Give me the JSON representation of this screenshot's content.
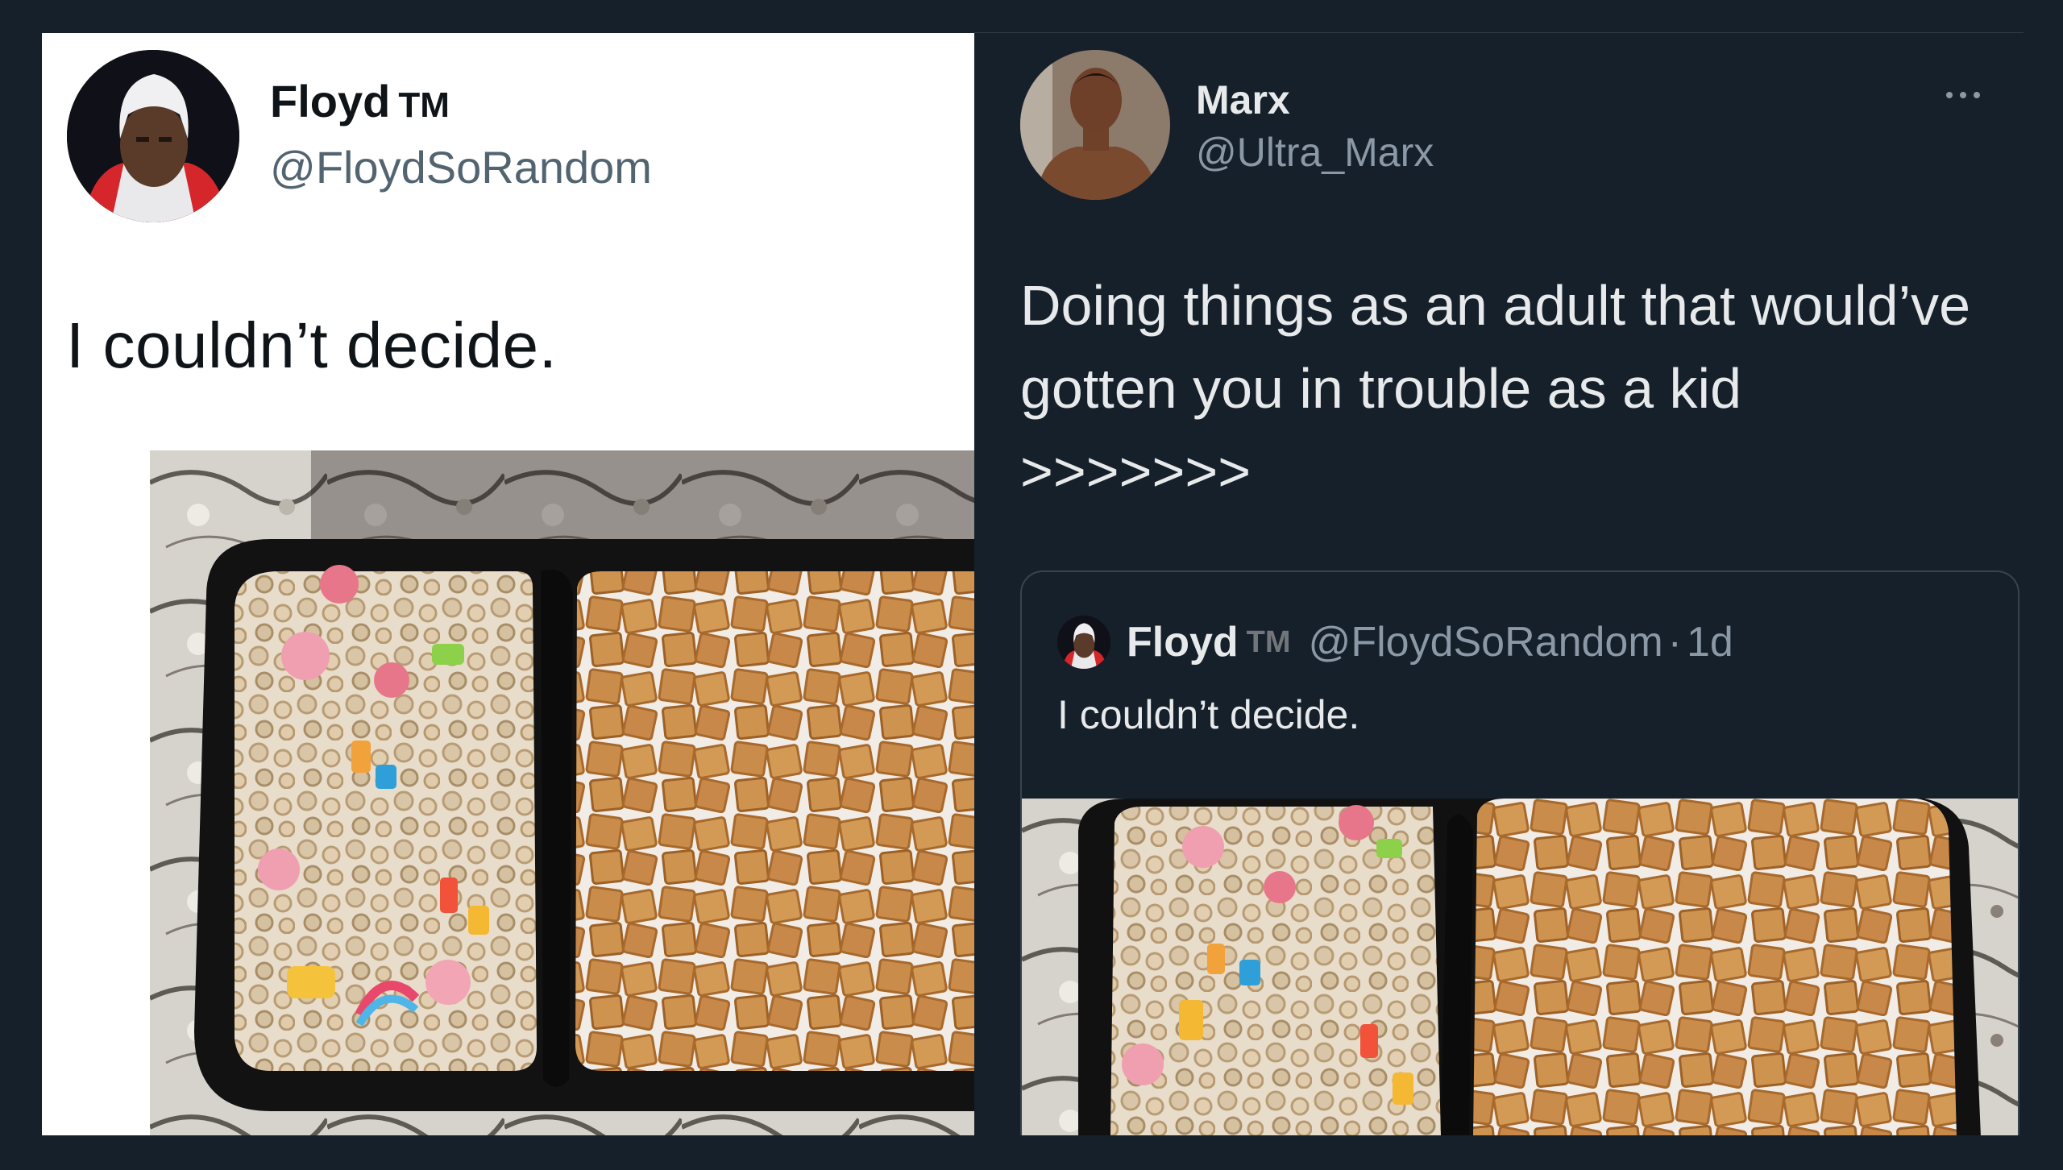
{
  "left_tweet": {
    "name": "Floyd",
    "badge": "TM",
    "handle": "@FloydSoRandom",
    "text": "I couldn’t decide.",
    "image_icon": "cereal-photo"
  },
  "right_tweet": {
    "name": "Marx",
    "handle": "@Ultra_Marx",
    "text": "Doing things as an adult that would’ve gotten you in trouble as a kid >>>>>>>",
    "more_icon": "ellipsis-icon",
    "quote": {
      "name": "Floyd",
      "badge": "TM",
      "handle": "@FloydSoRandom",
      "dot": "·",
      "time": "1d",
      "text": "I couldn’t decide."
    }
  },
  "colors": {
    "background": "#15202b",
    "light_card": "#ffffff",
    "text_dark": "#0f1419",
    "text_light": "#e7e9ea",
    "muted": "#8b98a5",
    "border": "#38444d"
  }
}
